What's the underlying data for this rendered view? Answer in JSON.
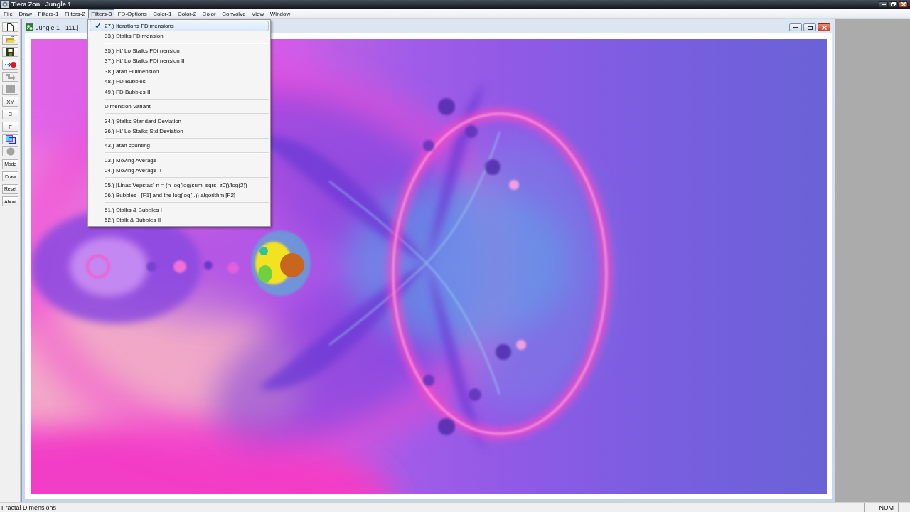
{
  "window": {
    "title": "Tiera Zon   Jungle 1"
  },
  "menu_bar": [
    {
      "label": "File",
      "selected": false
    },
    {
      "label": "Draw",
      "selected": false
    },
    {
      "label": "Filters-1",
      "selected": false
    },
    {
      "label": "Filters-2",
      "selected": false
    },
    {
      "label": "Filters-3",
      "selected": true
    },
    {
      "label": "FD-Options",
      "selected": false
    },
    {
      "label": "Color-1",
      "selected": false
    },
    {
      "label": "Color-2",
      "selected": false
    },
    {
      "label": "Color",
      "selected": false
    },
    {
      "label": "Convolve",
      "selected": false
    },
    {
      "label": "View",
      "selected": false
    },
    {
      "label": "Window",
      "selected": false
    }
  ],
  "dropdown": [
    {
      "kind": "item",
      "label": "27.) Iterations FDimensions",
      "checked": true,
      "selected": true
    },
    {
      "kind": "item",
      "label": "33.) Stalks FDimension",
      "checked": false,
      "selected": false
    },
    {
      "kind": "separator"
    },
    {
      "kind": "item",
      "label": "35.) Hi/ Lo Stalks FDimension",
      "checked": false,
      "selected": false
    },
    {
      "kind": "item",
      "label": "37.) Hi/ Lo Stalks FDimension II",
      "checked": false,
      "selected": false
    },
    {
      "kind": "item",
      "label": "38.) atan FDimension",
      "checked": false,
      "selected": false
    },
    {
      "kind": "item",
      "label": "48.) FD Bubbles",
      "checked": false,
      "selected": false
    },
    {
      "kind": "item",
      "label": "49.) FD Bubbles II",
      "checked": false,
      "selected": false
    },
    {
      "kind": "separator"
    },
    {
      "kind": "item",
      "label": "Dimension Variant",
      "checked": false,
      "selected": false
    },
    {
      "kind": "separator"
    },
    {
      "kind": "item",
      "label": "34.) Stalks Standard Deviation",
      "checked": false,
      "selected": false
    },
    {
      "kind": "item",
      "label": "36.) Hi/ Lo Stalks Std Deviation",
      "checked": false,
      "selected": false
    },
    {
      "kind": "separator"
    },
    {
      "kind": "item",
      "label": "43.) atan counting",
      "checked": false,
      "selected": false
    },
    {
      "kind": "separator"
    },
    {
      "kind": "item",
      "label": "03.) Moving Average I",
      "checked": false,
      "selected": false
    },
    {
      "kind": "item",
      "label": "04.) Moving Average II",
      "checked": false,
      "selected": false
    },
    {
      "kind": "separator"
    },
    {
      "kind": "item",
      "label": "05.) [Linas Vepstas] n = (n-log(log(sum_sqrs_z0))/log(2))",
      "checked": false,
      "selected": false
    },
    {
      "kind": "item",
      "label": "06.) Bubbles I [F1] and the log(log(..)) algorithm [F2]",
      "checked": false,
      "selected": false
    },
    {
      "kind": "separator"
    },
    {
      "kind": "item",
      "label": "51.) Stalks & Bubbles I",
      "checked": false,
      "selected": false
    },
    {
      "kind": "item",
      "label": "52.) Stalk & Bubbles II",
      "checked": false,
      "selected": false
    }
  ],
  "toolbar": [
    {
      "kind": "icon",
      "disabled": false
    },
    {
      "kind": "icon",
      "disabled": false
    },
    {
      "kind": "icon",
      "disabled": false
    },
    {
      "kind": "icon",
      "disabled": false
    },
    {
      "kind": "icon",
      "disabled": true
    },
    {
      "kind": "icon",
      "disabled": true
    },
    {
      "kind": "letter",
      "label": "XY",
      "disabled": false
    },
    {
      "kind": "letter",
      "label": "C",
      "disabled": false
    },
    {
      "kind": "letter",
      "label": "F",
      "disabled": false
    },
    {
      "kind": "icon",
      "disabled": false
    },
    {
      "kind": "icon",
      "disabled": true
    },
    {
      "kind": "word",
      "label": "Mode",
      "disabled": false
    },
    {
      "kind": "word",
      "label": "Draw",
      "disabled": false
    },
    {
      "kind": "word",
      "label": "Reset",
      "disabled": false
    },
    {
      "kind": "word",
      "label": "About",
      "disabled": false
    }
  ],
  "document_window": {
    "title": "Jungle 1 - 111.j"
  },
  "status_bar": {
    "message": "Fractal Dimensions",
    "indicator": "NUM"
  }
}
